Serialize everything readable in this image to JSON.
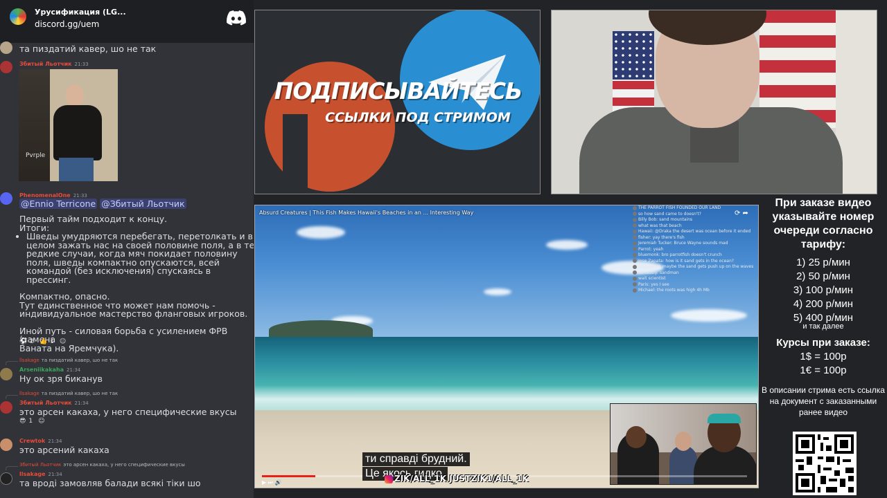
{
  "server": {
    "name": "Урусификация (LG...",
    "link": "discord.gg/uem",
    "logo_icon": "discord-logo-icon"
  },
  "chat": {
    "top_message": "та пиздатий кавер, шо не так",
    "messages": [
      {
        "user": "Збитый Льотчик",
        "time": "21:33",
        "user_color": "#e74c3c"
      },
      {
        "user": "PhenomenalOne",
        "time": "21:33",
        "user_color": "#e74c3c"
      }
    ],
    "photo_watermark": "Pvrple",
    "mentions": [
      "@Ennio Terricone",
      "@Збитый Льотчик"
    ],
    "long_message": {
      "intro": "Первый тайм подходит к концу.",
      "results_label": "Итоги:",
      "bullet": "Шведы умудряются перебегать, перетолкать и в целом зажать нас на своей половине поля, а в те редкие случаи, когда мяч покидает половину поля, шведы компактно опускаются, всей командой (без исключения) спускаясь в прессинг.",
      "p2_line1": "Компактно, опасно.",
      "p2_line2": "Тут единственное что может нам помочь -",
      "p2_line3": "индивидуальное мастерство фланговых игроков.",
      "p3_line1": "Иной путь - силовая борьба с усилением ФРВ (замена",
      "p3_line2": "Ваната на Яремчука)."
    },
    "reactions_1": [
      "2",
      "1"
    ],
    "reply_1": {
      "user": "llsakage",
      "text": "та пиздатий кавер, шо не так"
    },
    "msg_arsen": {
      "user": "Arseniikakaha",
      "time": "21:34",
      "text": "Ну ок зря биканув"
    },
    "reply_2": {
      "user": "llsakage",
      "text": "та пиздатий кавер, шо не так"
    },
    "msg_zb": {
      "user": "Збитый Льотчик",
      "time": "21:34",
      "text": "это арсен какаха, у него специфические вкусы"
    },
    "reactions_2": [
      "1"
    ],
    "msg_crew": {
      "user": "Crewtok",
      "time": "21:34",
      "text": "это арсений какаха"
    },
    "reply_3": {
      "user": "Збитый Льотчик",
      "text": "это арсен какаха, у него специфические вкусы"
    },
    "msg_last": {
      "user": "llsakage",
      "time": "21:34",
      "text": "та вроді замовляв балади всякі тіки шо"
    }
  },
  "banner": {
    "title": "ПОДПИСЫВАЙТЕСЬ",
    "subtitle": "ССЫЛКИ ПОД СТРИМОМ",
    "patreon_color": "#c7512f",
    "telegram_color": "#2a8fd2"
  },
  "info": {
    "heading": "При заказе видео указывайте номер очереди согласно тарифу:",
    "prices": [
      "1) 25 р/мин",
      "2) 50 р/мин",
      "3) 100 р/мин",
      "4) 200 р/мин",
      "5) 400 р/мин"
    ],
    "etc": "и так далее",
    "courses_heading": "Курсы при заказе:",
    "rates": [
      "1$ = 100р",
      "1€ = 100р"
    ],
    "description": "В описании стрима есть ссылка на документ с заказанными ранее видео"
  },
  "player": {
    "title": "Absurd Creatures | This Fish Makes Hawaii's Beaches in an ... Interesting Way",
    "progress": 0.11,
    "live_chat": [
      "THE PARROT FISH FOUNDED OUR LAND",
      "so how sand came to doesn't?",
      "Billy Bob: sand mountains",
      "what was that beach",
      "Hawaii: @Draka the desert was ocean before it ended",
      "fisher: yay there's fish",
      "Jeremiah Tucker: Bruce Wayne sounds mad",
      "Parrot: yeah",
      "bluemonk: bro parrotfish doesn't crunch",
      "Jose Zapata: how is it sand gets in the ocean?",
      "Kidpacked: maybe the sand gets push up on the waves",
      "Seriously: sandman",
      "wait scientist",
      "Paris: yes I see",
      "Michael: the roots was high 4h Mb"
    ],
    "subtitles": [
      "ти справді брудний.",
      "Це якось гидко."
    ],
    "socials": "ZIK/ALL_1K   JUSTZIK1/ALL_1K"
  }
}
